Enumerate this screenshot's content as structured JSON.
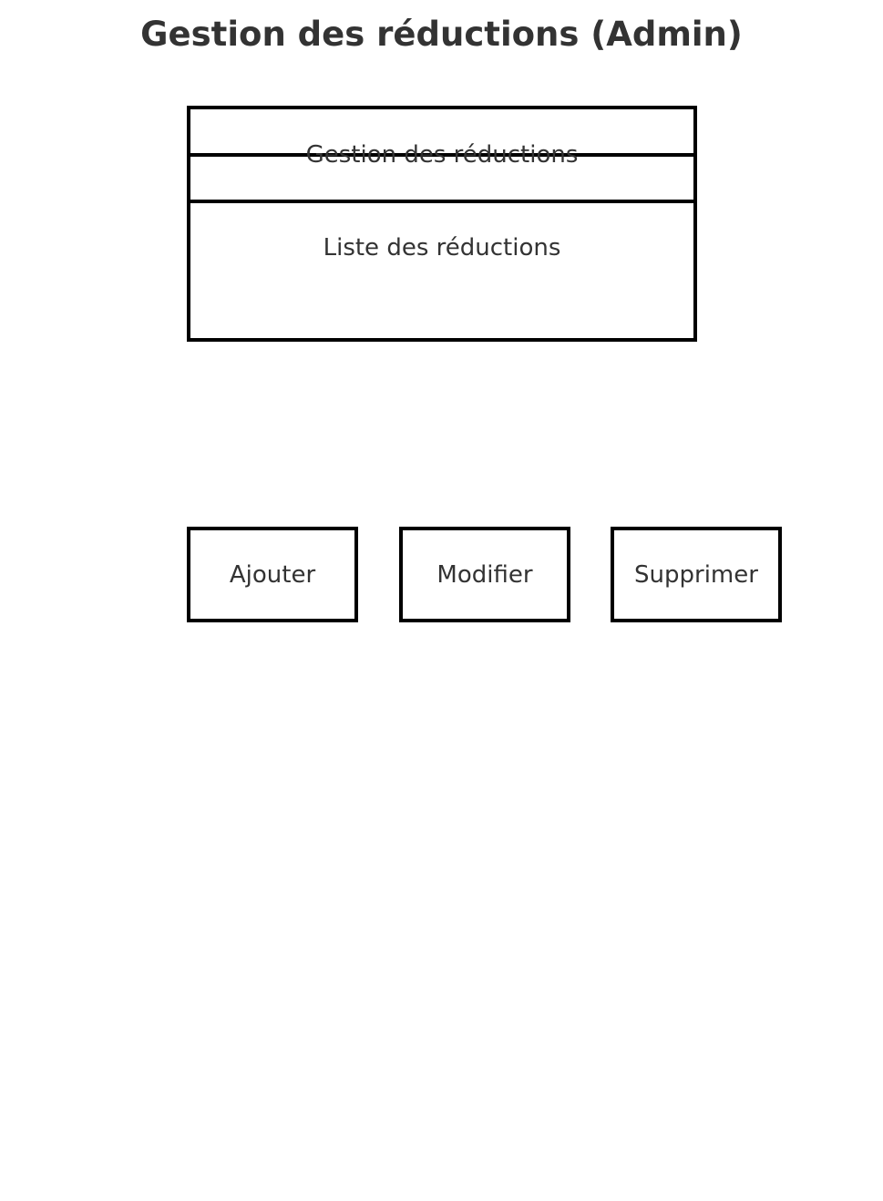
{
  "page": {
    "title": "Gestion des réductions (Admin)"
  },
  "panel": {
    "header_label": "Gestion des réductions",
    "list_label": "Liste des réductions"
  },
  "actions": {
    "add_label": "Ajouter",
    "edit_label": "Modifier",
    "delete_label": "Supprimer"
  },
  "colors": {
    "text": "#333333",
    "border": "#000000",
    "background": "#ffffff"
  }
}
